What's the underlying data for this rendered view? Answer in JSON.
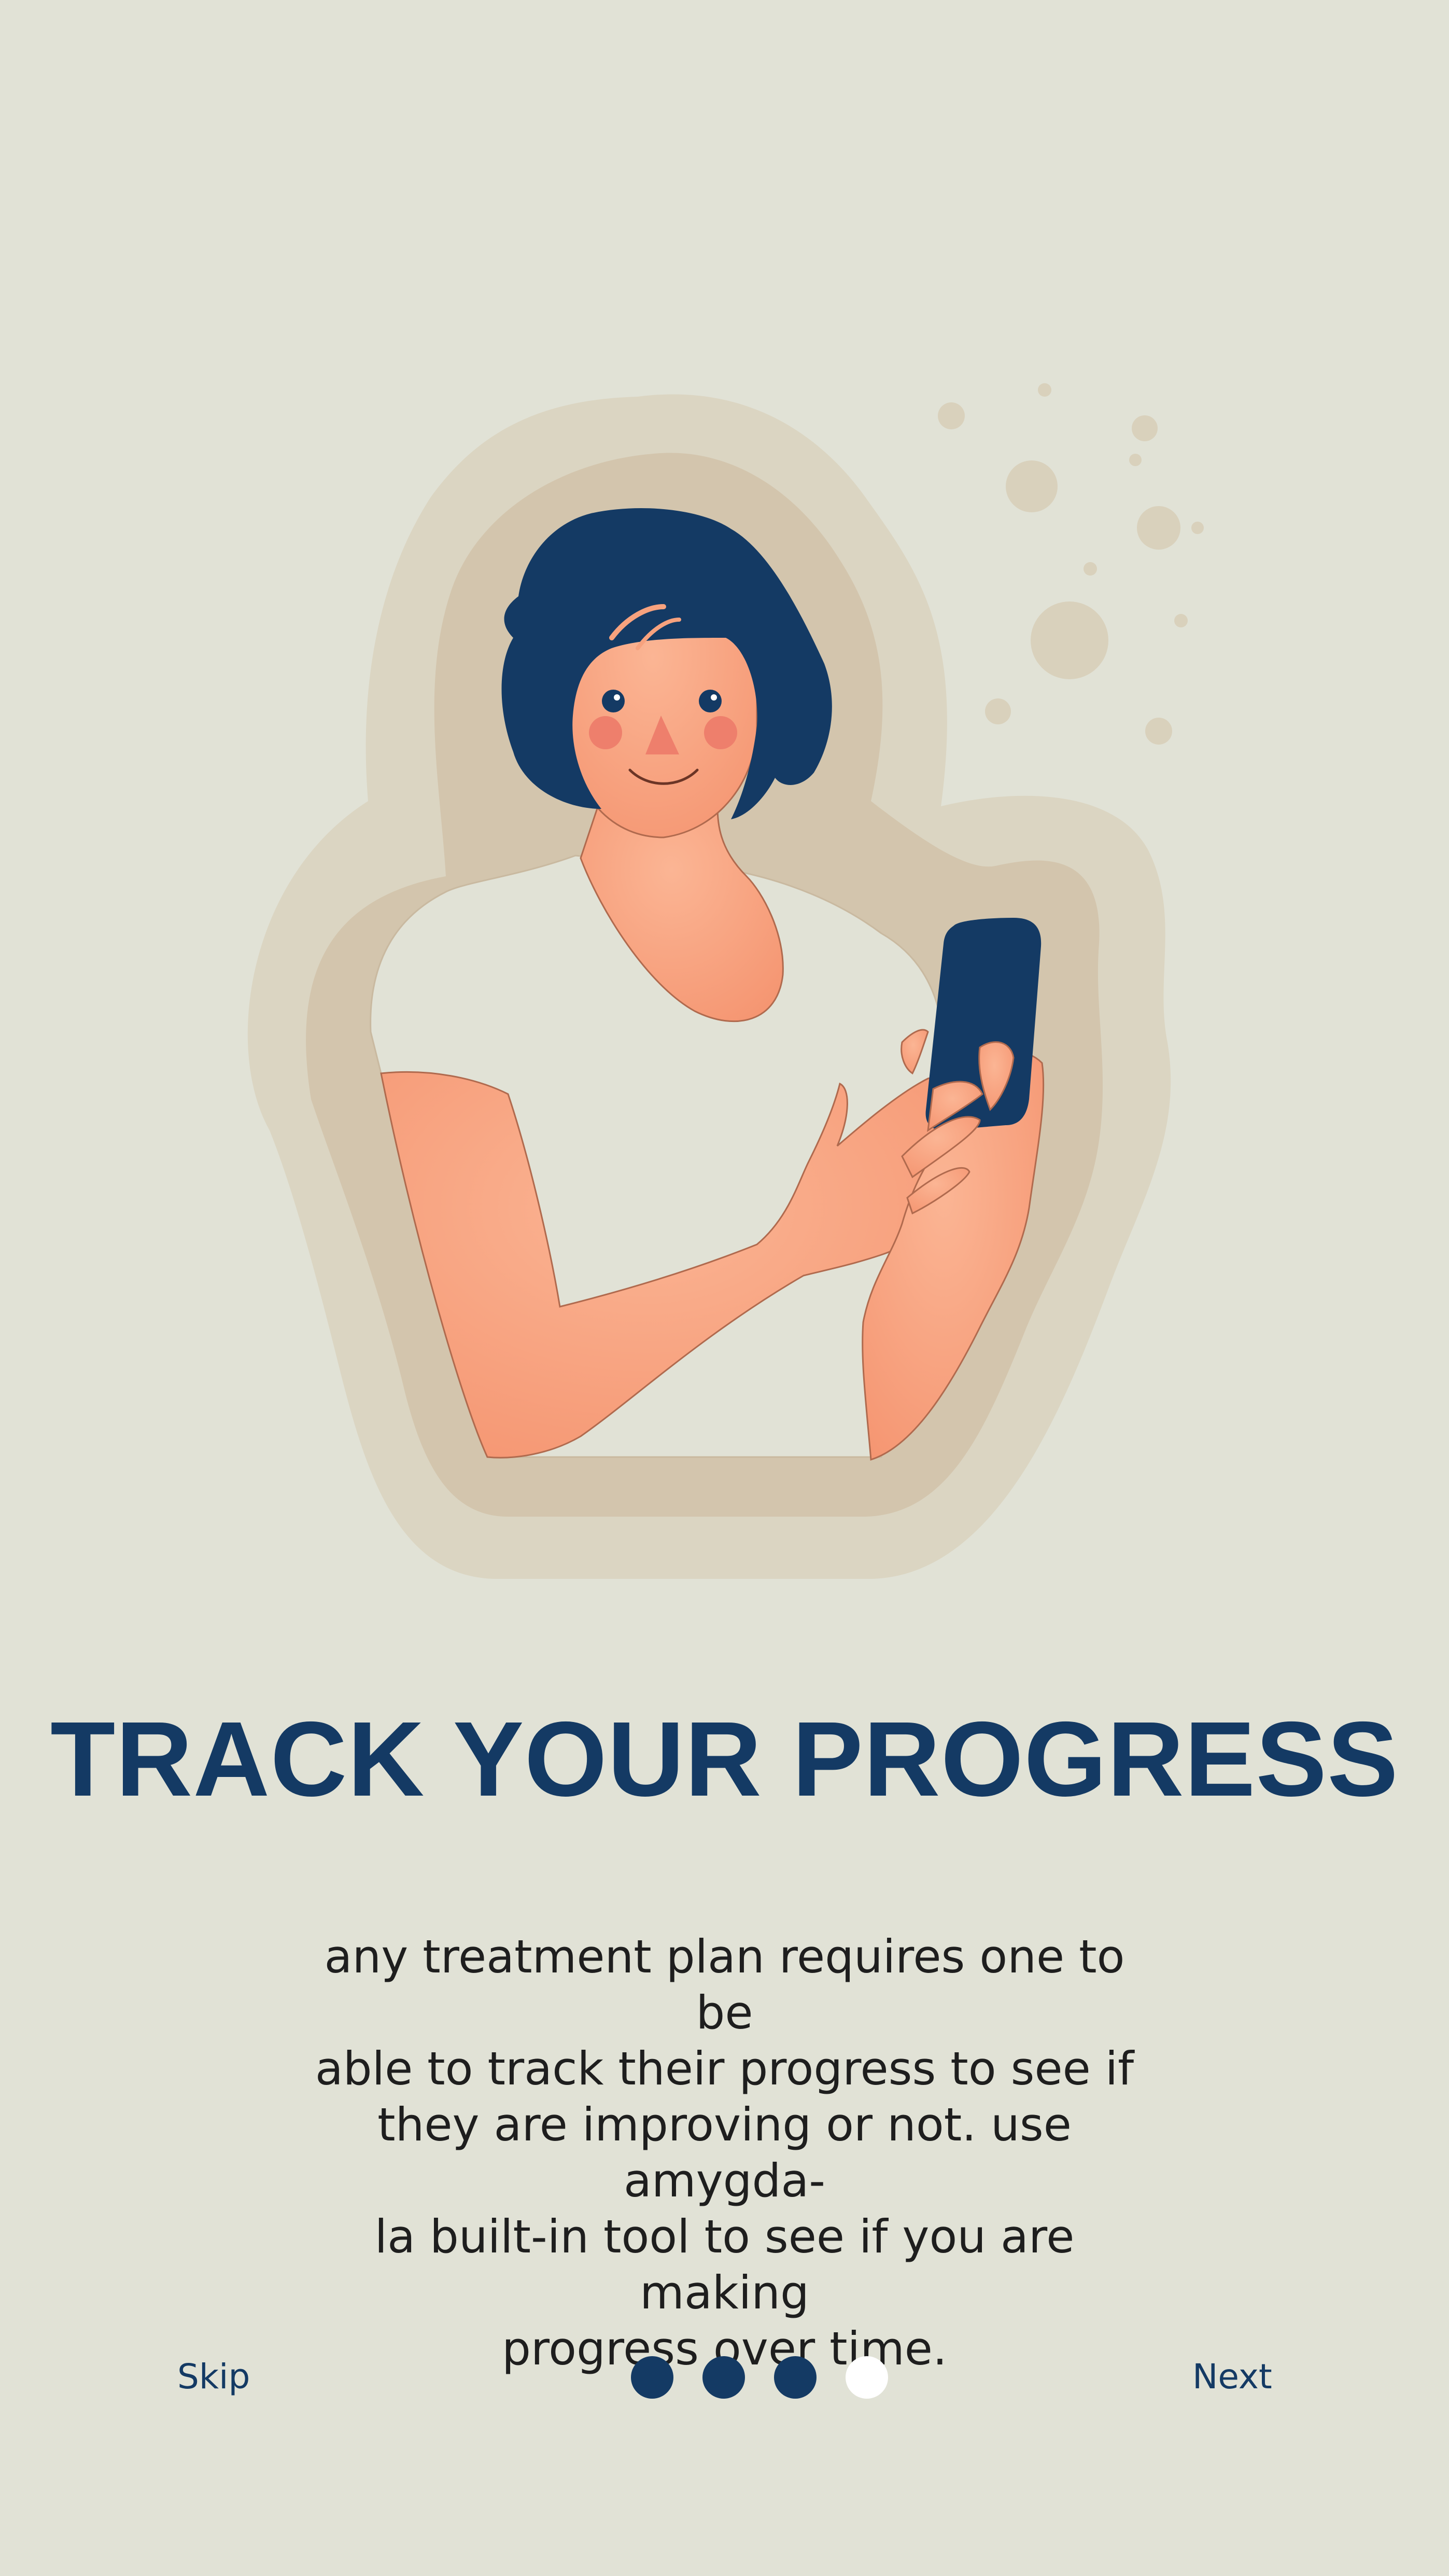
{
  "onboarding": {
    "title": "TRACK YOUR PROGRESS",
    "description": "any treatment plan requires one to be\nable to track their progress to see if\nthey are improving or not. use amygda-\nla built-in tool to see if you are making\nprogress over time.",
    "illustration_subject": "woman-holding-phone"
  },
  "nav": {
    "skip_label": "Skip",
    "next_label": "Next",
    "page_indicator": {
      "total_pages": 4,
      "dots": [
        "filled",
        "filled",
        "filled",
        "empty"
      ]
    }
  },
  "colors": {
    "background": "#E1E2D6",
    "primary": "#143A64",
    "skin": "#F7A27E",
    "halo_outer": "#DBD5C2",
    "halo_inner": "#D3C5AD",
    "dot_inactive": "#FFFFFF"
  }
}
